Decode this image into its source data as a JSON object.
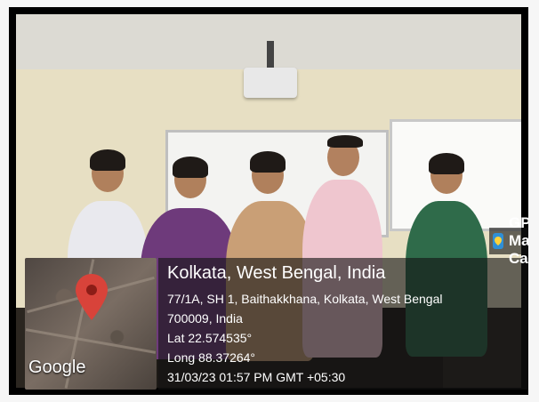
{
  "overlay": {
    "camera_tag": "GPS Map Camera",
    "location_title": "Kolkata, West Bengal, India",
    "address_line_1": "77/1A, SH 1, Baithakkhana, Kolkata, West Bengal",
    "address_line_2": "700009, India",
    "latitude": "Lat 22.574535°",
    "longitude": "Long 88.37264°",
    "datetime": "31/03/23 01:57 PM GMT +05:30",
    "map_brand": "Google"
  },
  "colors": {
    "map_pin": "#d8433a",
    "overlay_bg": "rgba(20,20,20,0.62)",
    "frame": "#000000"
  },
  "icons": [
    "camera-icon",
    "map-pin-icon"
  ]
}
